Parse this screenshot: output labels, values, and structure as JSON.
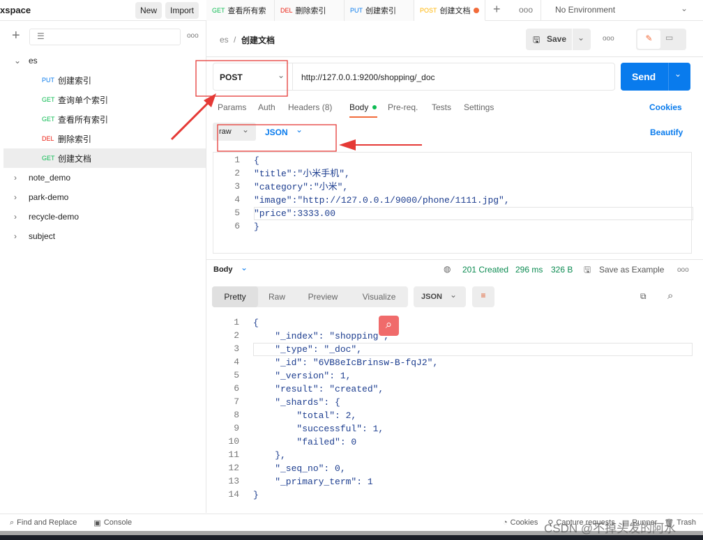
{
  "workspace": {
    "title": "xspace",
    "new": "New",
    "import": "Import"
  },
  "tabs": [
    {
      "method": "GET",
      "label": "查看所有索",
      "color": "#0cbb52",
      "dirty": true
    },
    {
      "method": "DEL",
      "label": "删除索引",
      "color": "#eb2013",
      "dirty": false
    },
    {
      "method": "PUT",
      "label": "创建索引",
      "color": "#097bed",
      "dirty": false
    },
    {
      "method": "POST",
      "label": "创建文档",
      "color": "#ffb400",
      "dirty": true
    }
  ],
  "environment": "No Environment",
  "sidebar": {
    "collections": [
      {
        "name": "es",
        "expanded": true,
        "requests": [
          {
            "method": "PUT",
            "label": "创建索引",
            "color": "#097bed"
          },
          {
            "method": "GET",
            "label": "查询单个索引",
            "color": "#0cbb52"
          },
          {
            "method": "GET",
            "label": "查看所有索引",
            "color": "#0cbb52"
          },
          {
            "method": "DEL",
            "label": "删除索引",
            "color": "#eb2013"
          },
          {
            "method": "GET",
            "label": "创建文档",
            "color": "#0cbb52",
            "active": true
          }
        ]
      },
      {
        "name": "note_demo"
      },
      {
        "name": "park-demo"
      },
      {
        "name": "recycle-demo"
      },
      {
        "name": "subject"
      }
    ]
  },
  "breadcrumb": {
    "parent": "es",
    "sep": "/",
    "current": "创建文档"
  },
  "header": {
    "save": "Save"
  },
  "request": {
    "method": "POST",
    "url": "http://127.0.0.1:9200/shopping/_doc",
    "send": "Send",
    "tabs": [
      "Params",
      "Auth",
      "Headers (8)",
      "Body",
      "Pre-req.",
      "Tests",
      "Settings"
    ],
    "active_tab": "Body",
    "cookies": "Cookies",
    "body_mode": "raw",
    "body_lang": "JSON",
    "beautify": "Beautify",
    "body_lines": [
      "{",
      "\"title\":\"小米手机\",",
      "\"category\":\"小米\",",
      "\"image\":\"http://127.0.0.1/9000/phone/1111.jpg\",",
      "\"price\":3333.00",
      "}"
    ]
  },
  "response": {
    "label": "Body",
    "status": "201 Created",
    "time": "296 ms",
    "size": "326 B",
    "save_example": "Save as Example",
    "views": [
      "Pretty",
      "Raw",
      "Preview",
      "Visualize"
    ],
    "active_view": "Pretty",
    "format": "JSON",
    "lines": [
      "{",
      "    \"_index\": \"shopping\",",
      "    \"_type\": \"_doc\",",
      "    \"_id\": \"6VB8eIcBrinsw-B-fqJ2\",",
      "    \"_version\": 1,",
      "    \"result\": \"created\",",
      "    \"_shards\": {",
      "        \"total\": 2,",
      "        \"successful\": 1,",
      "        \"failed\": 0",
      "    },",
      "    \"_seq_no\": 0,",
      "    \"_primary_term\": 1",
      "}"
    ]
  },
  "statusbar": {
    "find": "Find and Replace",
    "console": "Console",
    "cookies": "Cookies",
    "capture": "Capture requests",
    "runner": "Runner",
    "trash": "Trash"
  },
  "watermark": "CSDN @不掉头发的阿水"
}
